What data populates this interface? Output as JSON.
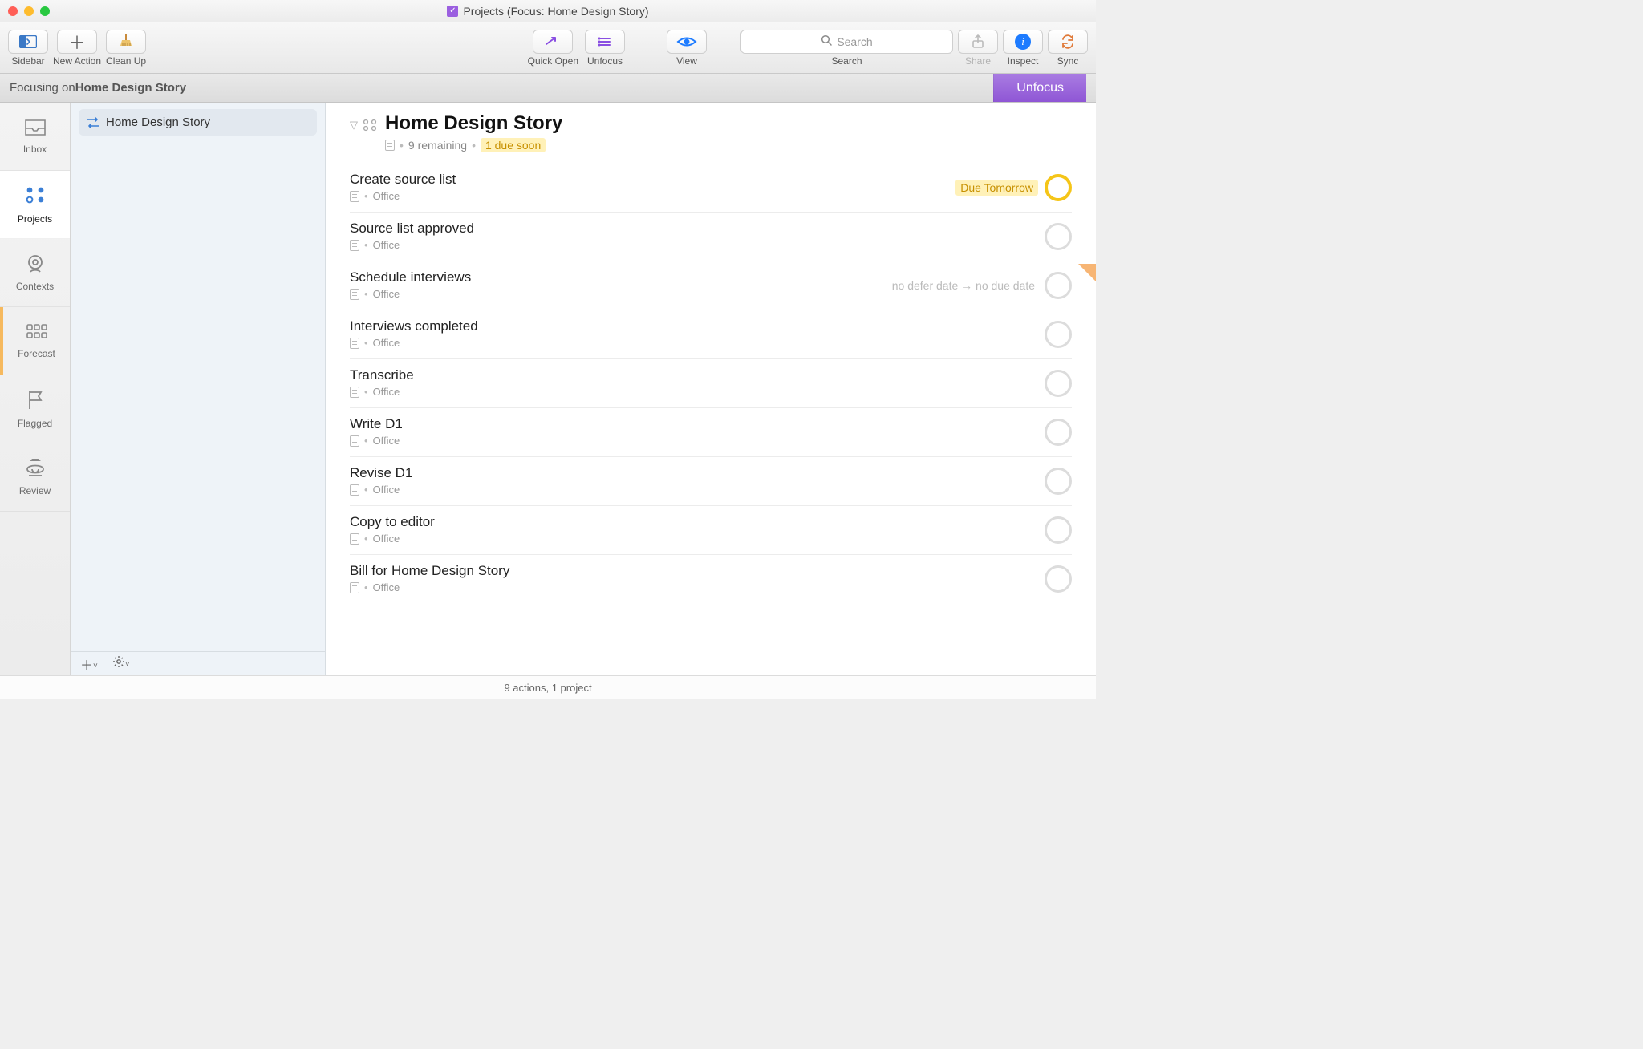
{
  "window_title": "Projects (Focus: Home Design Story)",
  "toolbar": {
    "sidebar": "Sidebar",
    "new_action": "New Action",
    "clean_up": "Clean Up",
    "quick_open": "Quick Open",
    "unfocus": "Unfocus",
    "view": "View",
    "search_placeholder": "Search",
    "search_label": "Search",
    "share": "Share",
    "inspect": "Inspect",
    "sync": "Sync"
  },
  "focusbar": {
    "prefix": "Focusing on ",
    "subject": "Home Design Story",
    "unfocus": "Unfocus"
  },
  "perspectives": [
    {
      "id": "inbox",
      "label": "Inbox"
    },
    {
      "id": "projects",
      "label": "Projects"
    },
    {
      "id": "contexts",
      "label": "Contexts"
    },
    {
      "id": "forecast",
      "label": "Forecast"
    },
    {
      "id": "flagged",
      "label": "Flagged"
    },
    {
      "id": "review",
      "label": "Review"
    }
  ],
  "project_list": {
    "items": [
      {
        "label": "Home Design Story"
      }
    ]
  },
  "project": {
    "title": "Home Design Story",
    "remaining": "9 remaining",
    "due_soon_badge": "1 due soon"
  },
  "tasks": [
    {
      "title": "Create source list",
      "context": "Office",
      "due_text": "Due Tomorrow",
      "due_soon": true,
      "flagged": false,
      "dates_text": ""
    },
    {
      "title": "Source list approved",
      "context": "Office",
      "due_text": "",
      "due_soon": false,
      "flagged": false,
      "dates_text": ""
    },
    {
      "title": "Schedule interviews",
      "context": "Office",
      "due_text": "",
      "due_soon": false,
      "flagged": true,
      "dates_text": "no defer date → no due date"
    },
    {
      "title": "Interviews completed",
      "context": "Office",
      "due_text": "",
      "due_soon": false,
      "flagged": false,
      "dates_text": ""
    },
    {
      "title": "Transcribe",
      "context": "Office",
      "due_text": "",
      "due_soon": false,
      "flagged": false,
      "dates_text": ""
    },
    {
      "title": "Write D1",
      "context": "Office",
      "due_text": "",
      "due_soon": false,
      "flagged": false,
      "dates_text": ""
    },
    {
      "title": "Revise D1",
      "context": "Office",
      "due_text": "",
      "due_soon": false,
      "flagged": false,
      "dates_text": ""
    },
    {
      "title": "Copy to editor",
      "context": "Office",
      "due_text": "",
      "due_soon": false,
      "flagged": false,
      "dates_text": ""
    },
    {
      "title": "Bill for Home Design Story",
      "context": "Office",
      "due_text": "",
      "due_soon": false,
      "flagged": false,
      "dates_text": ""
    }
  ],
  "statusbar": "9 actions, 1 project"
}
